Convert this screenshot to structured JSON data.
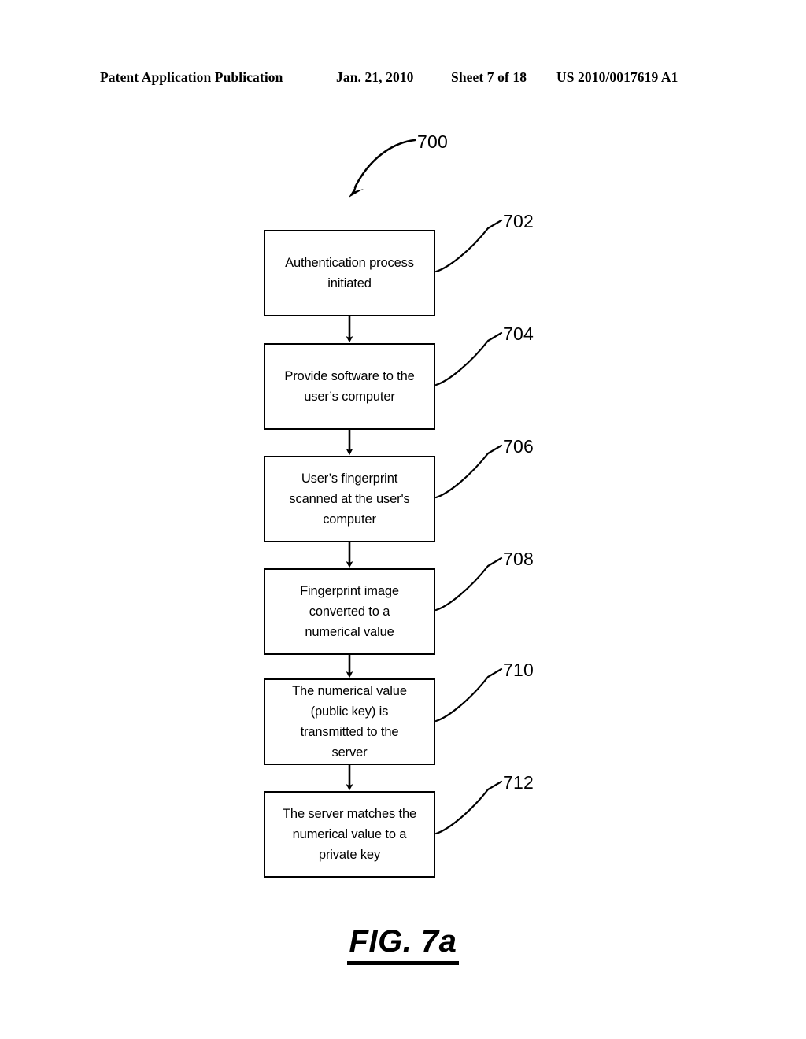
{
  "header": {
    "publication": "Patent Application Publication",
    "date": "Jan. 21, 2010",
    "sheet": "Sheet 7 of 18",
    "patent_number": "US 2010/0017619 A1"
  },
  "figure": {
    "caption": "FIG. 7a",
    "diagram_reference": "700",
    "line_color": "#000000",
    "background_color": "#ffffff"
  },
  "flowchart": {
    "steps": [
      {
        "ref": "702",
        "text": "Authentication process\ninitiated"
      },
      {
        "ref": "704",
        "text": "Provide software to the\nuser’s computer"
      },
      {
        "ref": "706",
        "text": "User’s fingerprint\nscanned at the user's\ncomputer"
      },
      {
        "ref": "708",
        "text": "Fingerprint image\nconverted to a\nnumerical value"
      },
      {
        "ref": "710",
        "text": "The numerical value\n(public key) is\ntransmitted to the\nserver"
      },
      {
        "ref": "712",
        "text": "The server matches the\nnumerical value to a\nprivate key"
      }
    ]
  }
}
